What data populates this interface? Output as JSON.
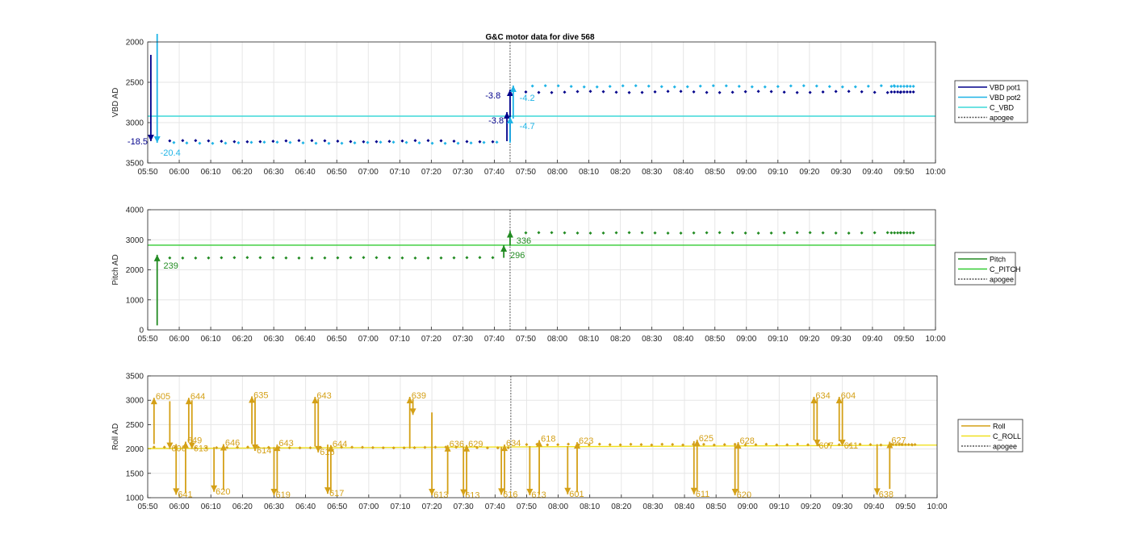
{
  "title": "G&C motor data for dive 568",
  "x_ticks": [
    "05:50",
    "06:00",
    "06:10",
    "06:20",
    "06:30",
    "06:40",
    "06:50",
    "07:00",
    "07:10",
    "07:20",
    "07:30",
    "07:40",
    "07:50",
    "08:00",
    "08:10",
    "08:20",
    "08:30",
    "08:40",
    "08:50",
    "09:00",
    "09:10",
    "09:20",
    "09:30",
    "09:40",
    "09:50",
    "10:00"
  ],
  "chart_data": [
    {
      "type": "scatter",
      "id": "vbd",
      "ylabel": "VBD AD",
      "ylim": [
        2000,
        3500
      ],
      "y_reversed": true,
      "y_ticks": [
        "2000",
        "2500",
        "3000",
        "3500"
      ],
      "xlim": [
        "05:50",
        "10:00"
      ],
      "grid": true,
      "legend_placement": "right",
      "legend": [
        {
          "label": "VBD pot1",
          "color": "#00008b",
          "style": "solid"
        },
        {
          "label": "VBD pot2",
          "color": "#1fb4e6",
          "style": "solid"
        },
        {
          "label": "C_VBD",
          "color": "#3fd8d8",
          "style": "solid"
        },
        {
          "label": "apogee",
          "color": "#555555",
          "style": "dotted"
        }
      ],
      "reference_line": {
        "name": "C_VBD",
        "y": 2920,
        "color": "#3fd8d8"
      },
      "apogee_x": "07:45",
      "series": [
        {
          "name": "VBD pot1",
          "color": "#00008b",
          "x_start": "05:57",
          "x_end": "07:43",
          "y": 3230,
          "x_start2": "07:50",
          "x_end2": "09:53",
          "y2": 2620
        },
        {
          "name": "VBD pot2",
          "color": "#1fb4e6",
          "x_start": "05:57",
          "x_end": "07:43",
          "y": 3250,
          "x_start2": "07:50",
          "x_end2": "09:53",
          "y2": 2550
        }
      ],
      "arrows": [
        {
          "x0": "05:51",
          "y0": 2160,
          "x1": "05:51",
          "y1": 3230,
          "color": "#00008b",
          "label": "-18.5",
          "lx": "05:50",
          "ly": 3230,
          "anchor": "end"
        },
        {
          "x0": "05:53",
          "y0": 1900,
          "x1": "05:53",
          "y1": 3250,
          "color": "#1fb4e6",
          "label": "-20.4",
          "lx": "05:54",
          "ly": 3370,
          "anchor": "start"
        },
        {
          "x0": "07:44",
          "y0": 3230,
          "x1": "07:44",
          "y1": 2870,
          "color": "#00008b",
          "label": "-3.8",
          "lx": "07:43",
          "ly": 2970,
          "anchor": "end"
        },
        {
          "x0": "07:45",
          "y0": 3230,
          "x1": "07:45",
          "y1": 2590,
          "color": "#00008b",
          "label": "-3.8",
          "lx": "07:42",
          "ly": 2660,
          "anchor": "end"
        },
        {
          "x0": "07:46",
          "y0": 2950,
          "x1": "07:46",
          "y1": 2540,
          "color": "#1fb4e6",
          "label": "-4.2",
          "lx": "07:48",
          "ly": 2690,
          "anchor": "start"
        },
        {
          "x0": "07:45",
          "y0": 3250,
          "x1": "07:45",
          "y1": 2930,
          "color": "#1fb4e6",
          "label": "-4.7",
          "lx": "07:48",
          "ly": 3040,
          "anchor": "start"
        }
      ]
    },
    {
      "type": "scatter",
      "id": "pitch",
      "ylabel": "Pitch AD",
      "ylim": [
        0,
        4000
      ],
      "y_reversed": false,
      "y_ticks": [
        "0",
        "1000",
        "2000",
        "3000",
        "4000"
      ],
      "xlim": [
        "05:50",
        "10:00"
      ],
      "grid": true,
      "legend_placement": "right",
      "legend": [
        {
          "label": "Pitch",
          "color": "#228b22",
          "style": "solid"
        },
        {
          "label": "C_PITCH",
          "color": "#33cc33",
          "style": "solid"
        },
        {
          "label": "apogee",
          "color": "#555555",
          "style": "dotted"
        }
      ],
      "reference_line": {
        "name": "C_PITCH",
        "y": 2820,
        "color": "#33cc33"
      },
      "apogee_x": "07:45",
      "series": [
        {
          "name": "Pitch",
          "color": "#228b22",
          "x_start": "05:57",
          "x_end": "07:43",
          "y": 2400,
          "x_start2": "07:50",
          "x_end2": "09:53",
          "y2": 3230
        }
      ],
      "arrows": [
        {
          "x0": "05:53",
          "y0": 150,
          "x1": "05:53",
          "y1": 2500,
          "color": "#228b22",
          "label": "239",
          "lx": "05:55",
          "ly": 2150,
          "anchor": "start"
        },
        {
          "x0": "07:43",
          "y0": 2400,
          "x1": "07:43",
          "y1": 2820,
          "color": "#228b22",
          "label": "296",
          "lx": "07:45",
          "ly": 2500,
          "anchor": "start"
        },
        {
          "x0": "07:45",
          "y0": 2800,
          "x1": "07:45",
          "y1": 3290,
          "color": "#228b22",
          "label": "336",
          "lx": "07:47",
          "ly": 2980,
          "anchor": "start"
        }
      ]
    },
    {
      "type": "scatter",
      "id": "roll",
      "ylabel": "Roll AD",
      "ylim": [
        1000,
        3500
      ],
      "y_reversed": false,
      "y_ticks": [
        "1000",
        "1500",
        "2000",
        "2500",
        "3000",
        "3500"
      ],
      "xlim": [
        "05:50",
        "10:00"
      ],
      "grid": true,
      "legend_placement": "right",
      "legend": [
        {
          "label": "Roll",
          "color": "#d4a017",
          "style": "solid"
        },
        {
          "label": "C_ROLL",
          "color": "#f0e020",
          "style": "solid"
        },
        {
          "label": "apogee",
          "color": "#555555",
          "style": "dotted"
        }
      ],
      "reference_line": {
        "name": "C_ROLL",
        "y": 2010,
        "y_end": 2080,
        "color": "#f0e020"
      },
      "apogee_x": "07:45",
      "series": [
        {
          "name": "Roll",
          "color": "#d4a017",
          "x_start": "05:52",
          "x_end": "07:45",
          "y": 2030,
          "x_start2": "07:50",
          "x_end2": "09:53",
          "y2": 2090
        }
      ],
      "arrows": [
        {
          "x0": "05:52",
          "y0": 2100,
          "x1": "05:52",
          "y1": 3050,
          "label": "605",
          "dir": "up"
        },
        {
          "x0": "05:57",
          "y0": 2980,
          "x1": "05:57",
          "y1": 2000,
          "label": "606",
          "dir": "down"
        },
        {
          "x0": "05:59",
          "y0": 2100,
          "x1": "05:59",
          "y1": 1060,
          "label": "641",
          "dir": "down"
        },
        {
          "x0": "06:02",
          "y0": 1100,
          "x1": "06:02",
          "y1": 2150,
          "label": "649",
          "dir": "up"
        },
        {
          "x0": "06:03",
          "y0": 2150,
          "x1": "06:03",
          "y1": 3050,
          "label": "644",
          "dir": "up"
        },
        {
          "x0": "06:04",
          "y0": 3000,
          "x1": "06:04",
          "y1": 2000,
          "label": "613",
          "dir": "down"
        },
        {
          "x0": "06:11",
          "y0": 2040,
          "x1": "06:11",
          "y1": 1120,
          "label": "620",
          "dir": "down"
        },
        {
          "x0": "06:14",
          "y0": 1160,
          "x1": "06:14",
          "y1": 2100,
          "label": "646",
          "dir": "up"
        },
        {
          "x0": "06:23",
          "y0": 2100,
          "x1": "06:23",
          "y1": 3080,
          "label": "635",
          "dir": "up"
        },
        {
          "x0": "06:24",
          "y0": 3050,
          "x1": "06:24",
          "y1": 1960,
          "label": "614",
          "dir": "down"
        },
        {
          "x0": "06:30",
          "y0": 2040,
          "x1": "06:30",
          "y1": 1050,
          "label": "619",
          "dir": "down"
        },
        {
          "x0": "06:31",
          "y0": 1100,
          "x1": "06:31",
          "y1": 2090,
          "label": "643",
          "dir": "up"
        },
        {
          "x0": "06:43",
          "y0": 2050,
          "x1": "06:43",
          "y1": 3070,
          "label": "643",
          "dir": "up"
        },
        {
          "x0": "06:44",
          "y0": 3030,
          "x1": "06:44",
          "y1": 1930,
          "label": "616",
          "dir": "down"
        },
        {
          "x0": "06:47",
          "y0": 2090,
          "x1": "06:47",
          "y1": 1080,
          "label": "617",
          "dir": "down"
        },
        {
          "x0": "06:48",
          "y0": 1110,
          "x1": "06:48",
          "y1": 2080,
          "label": "644",
          "dir": "up"
        },
        {
          "x0": "07:13",
          "y0": 2010,
          "x1": "07:13",
          "y1": 3070,
          "label": "639",
          "dir": "up"
        },
        {
          "x0": "07:14",
          "y0": 3030,
          "x1": "07:14",
          "y1": 2700,
          "label": "",
          "dir": "down"
        },
        {
          "x0": "07:20",
          "y0": 2750,
          "x1": "07:20",
          "y1": 1050,
          "label": "613",
          "dir": "down"
        },
        {
          "x0": "07:25",
          "y0": 1070,
          "x1": "07:25",
          "y1": 2080,
          "label": "636",
          "dir": "up"
        },
        {
          "x0": "07:30",
          "y0": 2050,
          "x1": "07:30",
          "y1": 1040,
          "label": "613",
          "dir": "down"
        },
        {
          "x0": "07:31",
          "y0": 1060,
          "x1": "07:31",
          "y1": 2080,
          "label": "629",
          "dir": "up"
        },
        {
          "x0": "07:42",
          "y0": 2040,
          "x1": "07:42",
          "y1": 1060,
          "label": "616",
          "dir": "down"
        },
        {
          "x0": "07:43",
          "y0": 1090,
          "x1": "07:43",
          "y1": 2090,
          "label": "634",
          "dir": "up"
        },
        {
          "x0": "07:51",
          "y0": 2060,
          "x1": "07:51",
          "y1": 1050,
          "label": "613",
          "dir": "down"
        },
        {
          "x0": "07:54",
          "y0": 1060,
          "x1": "07:54",
          "y1": 2180,
          "label": "618",
          "dir": "up"
        },
        {
          "x0": "08:03",
          "y0": 2060,
          "x1": "08:03",
          "y1": 1070,
          "label": "601",
          "dir": "down"
        },
        {
          "x0": "08:06",
          "y0": 1110,
          "x1": "08:06",
          "y1": 2140,
          "label": "623",
          "dir": "up"
        },
        {
          "x0": "08:43",
          "y0": 2160,
          "x1": "08:43",
          "y1": 1070,
          "label": "611",
          "dir": "down"
        },
        {
          "x0": "08:44",
          "y0": 1130,
          "x1": "08:44",
          "y1": 2190,
          "label": "625",
          "dir": "up"
        },
        {
          "x0": "08:56",
          "y0": 2110,
          "x1": "08:56",
          "y1": 1050,
          "label": "620",
          "dir": "down"
        },
        {
          "x0": "08:57",
          "y0": 1100,
          "x1": "08:57",
          "y1": 2140,
          "label": "628",
          "dir": "up"
        },
        {
          "x0": "09:21",
          "y0": 2180,
          "x1": "09:21",
          "y1": 3070,
          "label": "634",
          "dir": "up"
        },
        {
          "x0": "09:22",
          "y0": 3040,
          "x1": "09:22",
          "y1": 2060,
          "label": "607",
          "dir": "down"
        },
        {
          "x0": "09:29",
          "y0": 2160,
          "x1": "09:29",
          "y1": 3070,
          "label": "604",
          "dir": "up"
        },
        {
          "x0": "09:30",
          "y0": 3040,
          "x1": "09:30",
          "y1": 2060,
          "label": "611",
          "dir": "down"
        },
        {
          "x0": "09:41",
          "y0": 2100,
          "x1": "09:41",
          "y1": 1060,
          "label": "638",
          "dir": "down"
        },
        {
          "x0": "09:45",
          "y0": 1180,
          "x1": "09:45",
          "y1": 2150,
          "label": "627",
          "dir": "up"
        }
      ]
    }
  ]
}
